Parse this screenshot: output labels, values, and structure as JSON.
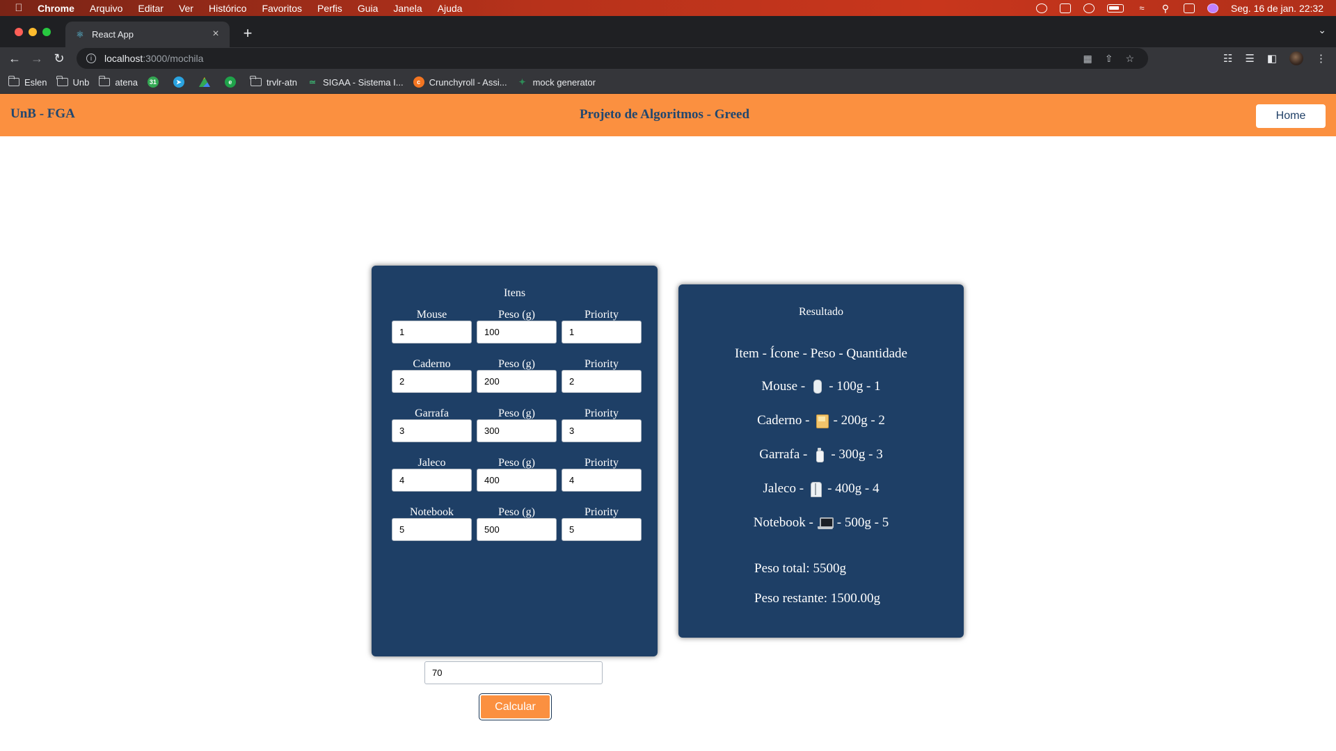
{
  "menubar": {
    "app": "Chrome",
    "items": [
      "Arquivo",
      "Editar",
      "Ver",
      "Histórico",
      "Favoritos",
      "Perfis",
      "Guia",
      "Janela",
      "Ajuda"
    ],
    "datetime": "Seg. 16 de jan.  22:32"
  },
  "browser": {
    "tab_title": "React App",
    "url_host": "localhost",
    "url_path": ":3000/mochila",
    "bookmarks": [
      "Eslen",
      "Unb",
      "atena",
      "trvlr-atn",
      "SIGAA - Sistema I...",
      "Crunchyroll - Assi...",
      "mock generator"
    ]
  },
  "colors": {
    "header_bg": "#fb9040",
    "card_bg": "#1e3f66",
    "brand_text": "#21476f"
  },
  "header": {
    "brand": "UnB - FGA",
    "title": "Projeto de Algoritmos - Greed",
    "home_label": "Home"
  },
  "items_form": {
    "title": "Itens",
    "rows": [
      {
        "name": "Mouse",
        "weight_label": "Peso (g)",
        "priority_label": "Priority",
        "qty": "1",
        "weight": "100",
        "priority": "1"
      },
      {
        "name": "Caderno",
        "weight_label": "Peso (g)",
        "priority_label": "Priority",
        "qty": "2",
        "weight": "200",
        "priority": "2"
      },
      {
        "name": "Garrafa",
        "weight_label": "Peso (g)",
        "priority_label": "Priority",
        "qty": "3",
        "weight": "300",
        "priority": "3"
      },
      {
        "name": "Jaleco",
        "weight_label": "Peso (g)",
        "priority_label": "Priority",
        "qty": "4",
        "weight": "400",
        "priority": "4"
      },
      {
        "name": "Notebook",
        "weight_label": "Peso (g)",
        "priority_label": "Priority",
        "qty": "5",
        "weight": "500",
        "priority": "5"
      }
    ],
    "capacity": "70",
    "calculate_label": "Calcular"
  },
  "result": {
    "title": "Resultado",
    "header": "Item - Ícone - Peso - Quantidade",
    "lines": [
      {
        "name": "Mouse -",
        "icon": "mouse-icon",
        "rest": "- 100g - 1"
      },
      {
        "name": "Caderno -",
        "icon": "notebook-icon",
        "rest": "- 200g - 2"
      },
      {
        "name": "Garrafa -",
        "icon": "bottle-icon",
        "rest": "- 300g - 3"
      },
      {
        "name": "Jaleco -",
        "icon": "lab-coat-icon",
        "rest": "- 400g - 4"
      },
      {
        "name": "Notebook -",
        "icon": "laptop-icon",
        "rest": "- 500g - 5"
      }
    ],
    "total": "Peso total: 5500g",
    "remaining": "Peso restante: 1500.00g"
  }
}
